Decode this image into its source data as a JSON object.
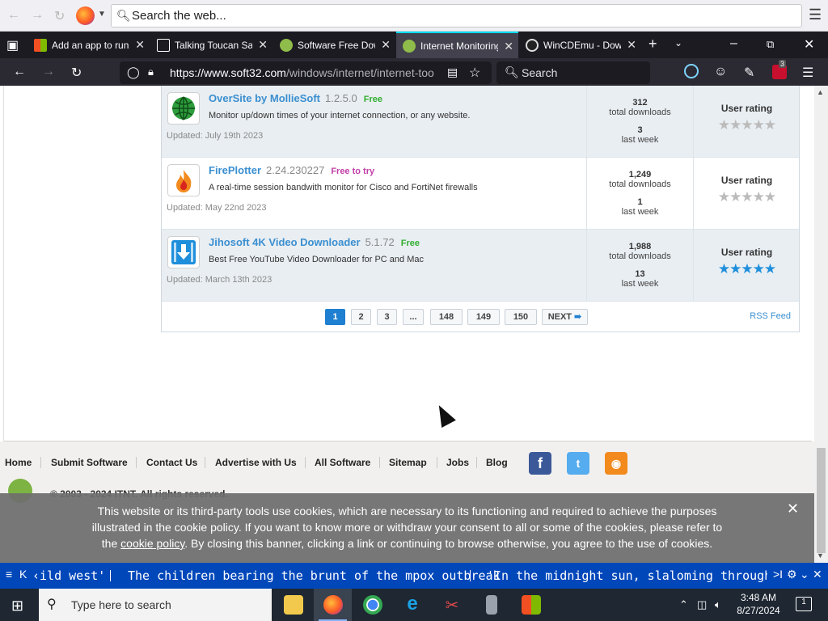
{
  "topbar": {
    "search_placeholder": "Search the web..."
  },
  "tabs": [
    {
      "title": "Add an app to run",
      "favicon_color": "#f25022"
    },
    {
      "title": "Talking Toucan Sa",
      "favicon_color": "#ffffff"
    },
    {
      "title": "Software Free Dow",
      "favicon_color": "#8fbc4a"
    },
    {
      "title": "Internet Monitoring",
      "favicon_color": "#8fbc4a",
      "active": true
    },
    {
      "title": "WinCDEmu - Dow",
      "favicon_color": "#222222"
    }
  ],
  "urlbar": {
    "url_host": "https://www.soft32.com",
    "url_path": "/windows/internet/internet-too",
    "search_placeholder": "Search",
    "extension_badge": "3"
  },
  "software": [
    {
      "name": "OverSite by MollieSoft",
      "version": "1.2.5.0",
      "license": "Free",
      "description": "Monitor up/down times of your internet connection, or any website.",
      "updated": "Updated: July 19th 2023",
      "total_downloads": "312",
      "total_label": "total downloads",
      "last_week": "3",
      "last_week_label": "last week",
      "rating_label": "User rating",
      "stars": 0
    },
    {
      "name": "FirePlotter",
      "version": "2.24.230227",
      "license": "Free to try",
      "description": "A real-time session bandwith monitor for Cisco and FortiNet firewalls",
      "updated": "Updated: May 22nd 2023",
      "total_downloads": "1,249",
      "total_label": "total downloads",
      "last_week": "1",
      "last_week_label": "last week",
      "rating_label": "User rating",
      "stars": 0
    },
    {
      "name": "Jihosoft 4K Video Downloader",
      "version": "5.1.72",
      "license": "Free",
      "description": "Best Free YouTube Video Downloader for PC and Mac",
      "updated": "Updated: March 13th 2023",
      "total_downloads": "1,988",
      "total_label": "total downloads",
      "last_week": "13",
      "last_week_label": "last week",
      "rating_label": "User rating",
      "stars": 5
    }
  ],
  "pagination": {
    "pages": [
      "1",
      "2",
      "3",
      "...",
      "148",
      "149",
      "150"
    ],
    "current": "1",
    "next_label": "NEXT",
    "rss_label": "RSS Feed"
  },
  "footer": {
    "links": [
      "Home",
      "Submit Software",
      "Contact Us",
      "Advertise with Us",
      "All Software",
      "Sitemap",
      "Jobs",
      "Blog"
    ],
    "copyright_partial": "© 2003 - 2024 ITNT. All rights reserved."
  },
  "cookie": {
    "line1": "This website or its third-party tools use cookies, which are necessary to its functioning and required to achieve the purposes",
    "line2": "illustrated in the cookie policy. If you want to know more or withdraw your consent to all or some of the cookies, please refer to",
    "line3_pre": "the ",
    "line3_link": "cookie policy",
    "line3_post": ". By closing this banner, clicking a link or continuing to browse otherwise, you agree to the use of cookies."
  },
  "ticker": {
    "items": [
      "‹ild west'",
      "The children bearing the brunt of the mpox outbreak",
      "'In the midnight sun, slaloming through icebe"
    ]
  },
  "taskbar": {
    "search_placeholder": "Type here to search",
    "time": "3:48 AM",
    "date": "8/27/2024",
    "notification_count": "1"
  },
  "colors": {
    "accent_link": "#3a8fd0",
    "free": "#2fae2f",
    "free_to_try": "#c23fa8",
    "ticker_bg": "#0047ba",
    "tab_bar_bg": "#1c1b22"
  }
}
